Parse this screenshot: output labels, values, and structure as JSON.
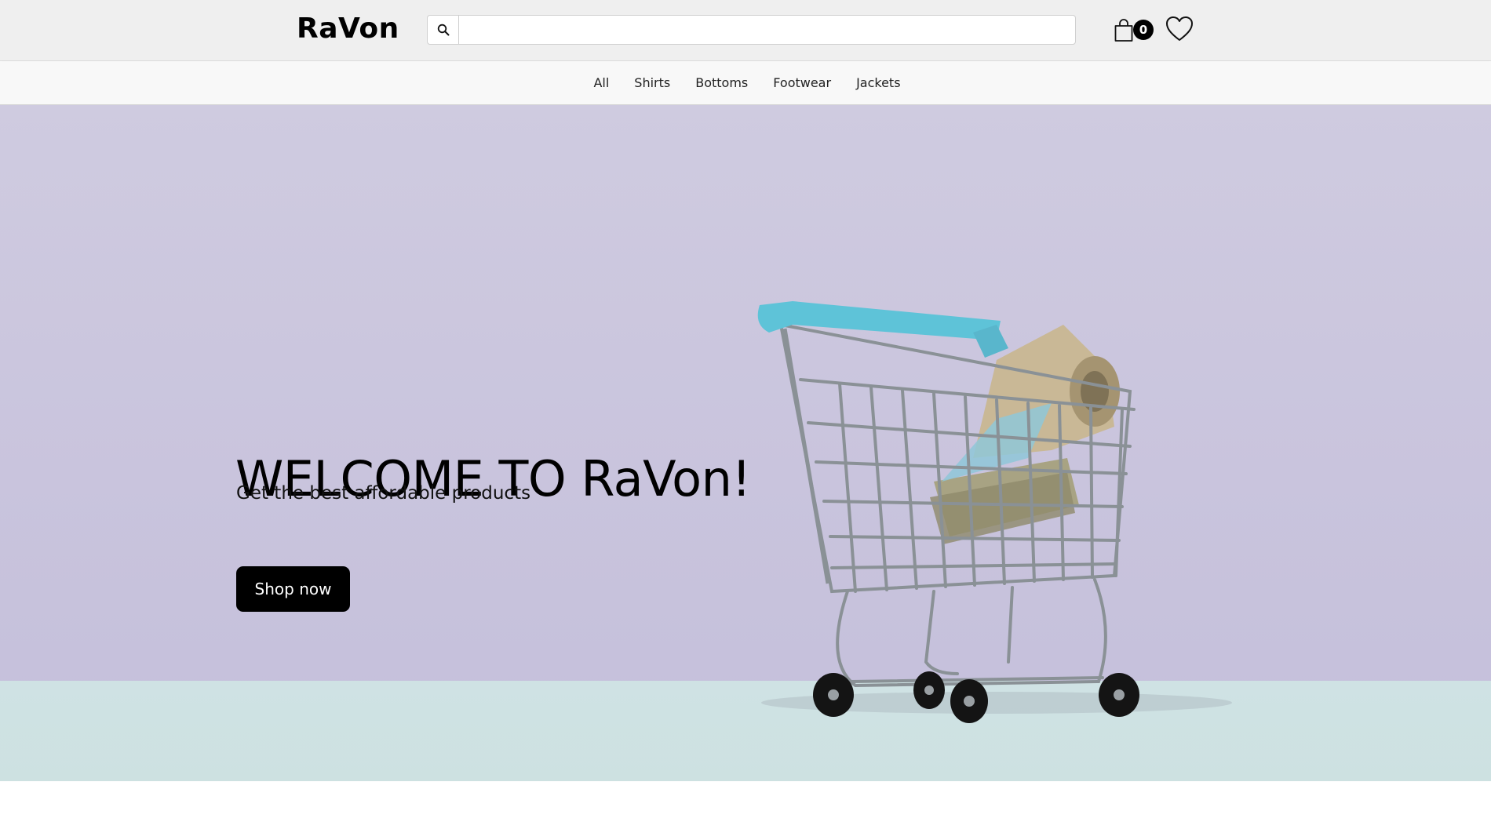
{
  "header": {
    "logo": "RaVon",
    "search": {
      "placeholder": "",
      "value": ""
    },
    "cart_count": "0",
    "icons": {
      "search": "search-icon",
      "cart": "shopping-bag-icon",
      "wishlist": "heart-icon"
    }
  },
  "categories": [
    "All",
    "Shirts",
    "Bottoms",
    "Footwear",
    "Jackets"
  ],
  "hero": {
    "title": "WELCOME TO RaVon!",
    "subtitle": "Get the best affordable products",
    "cta_label": "Shop now",
    "image_subject": "shopping-cart-with-money"
  },
  "colors": {
    "hero_background": "#cac5de",
    "hero_floor": "#cfe2e3",
    "button": "#000000",
    "cart_handle": "#5ac0d6"
  }
}
